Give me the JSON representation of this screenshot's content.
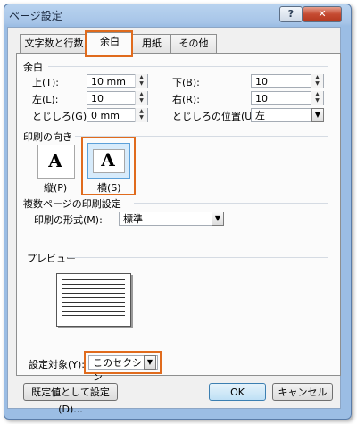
{
  "window": {
    "title": "ページ設定"
  },
  "titlebar": {
    "help": "?",
    "close": "✕"
  },
  "tabs": [
    {
      "label": "文字数と行数"
    },
    {
      "label": "余白"
    },
    {
      "label": "用紙"
    },
    {
      "label": "その他"
    }
  ],
  "margins": {
    "group_label": "余白",
    "top": {
      "label": "上(T):",
      "value": "10 mm"
    },
    "bottom": {
      "label": "下(B):",
      "value": "10"
    },
    "left": {
      "label": "左(L):",
      "value": "10"
    },
    "right": {
      "label": "右(R):",
      "value": "10"
    },
    "gutter": {
      "label": "とじしろ(G):",
      "value": "0 mm"
    },
    "gutter_pos": {
      "label": "とじしろの位置(U):",
      "value": "左"
    }
  },
  "orientation": {
    "group_label": "印刷の向き",
    "portrait": {
      "label": "縦(P)",
      "glyph": "A"
    },
    "landscape": {
      "label": "横(S)",
      "glyph": "A"
    }
  },
  "multipage": {
    "group_label": "複数ページの印刷設定",
    "format_label": "印刷の形式(M):",
    "format_value": "標準"
  },
  "preview": {
    "group_label": "プレビュー"
  },
  "apply_to": {
    "label": "設定対象(Y):",
    "value": "このセクション"
  },
  "buttons": {
    "default": "既定値として設定(D)...",
    "ok": "OK",
    "cancel": "キャンセル"
  },
  "colors": {
    "highlight": "#e06b1d"
  }
}
